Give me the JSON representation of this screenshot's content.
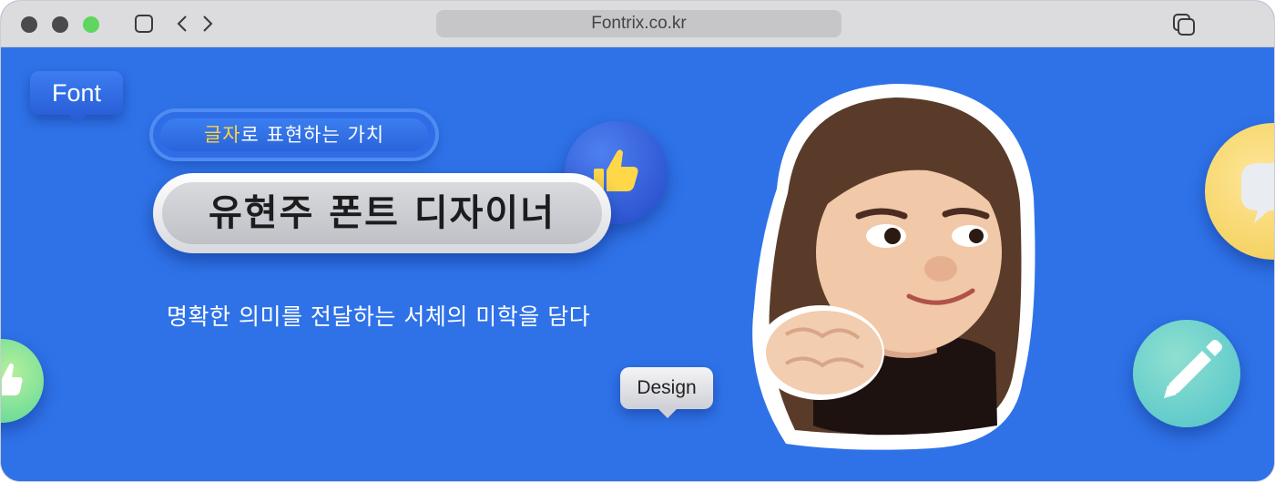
{
  "browser": {
    "url": "Fontrix.co.kr"
  },
  "bubbles": {
    "font": "Font",
    "design": "Design"
  },
  "headline": {
    "subtitle_highlight": "글자",
    "subtitle_rest": "로 표현하는 가치",
    "title": "유현주 폰트 디자이너",
    "tagline": "명확한 의미를 전달하는 서체의 미학을 담다"
  },
  "colors": {
    "background": "#2f72e8",
    "highlight": "#ffd23c"
  },
  "icons": [
    "thumbs-up-icon",
    "chat-icon",
    "pencil-icon",
    "memoji-avatar"
  ]
}
